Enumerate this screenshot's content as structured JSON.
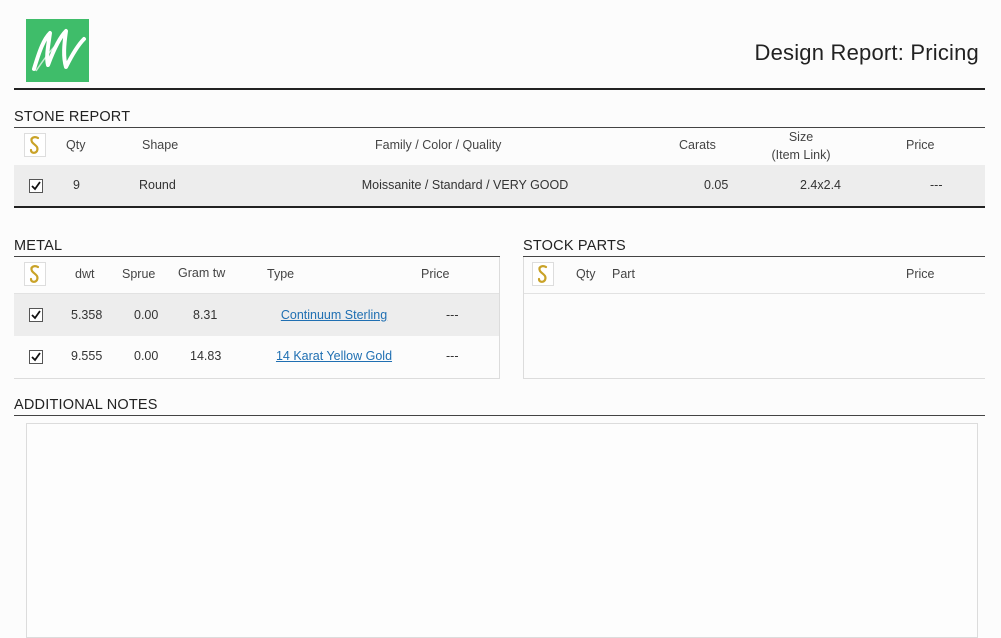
{
  "header": {
    "title": "Design Report: Pricing",
    "logo_icon": "green-m-logo"
  },
  "stone": {
    "section_title": "STONE REPORT",
    "columns": {
      "qty": "Qty",
      "shape": "Shape",
      "family": "Family / Color / Quality",
      "carats": "Carats",
      "size": "Size",
      "size_sub": "(Item Link)",
      "price": "Price"
    },
    "rows": [
      {
        "checked": true,
        "qty": "9",
        "shape": "Round",
        "family": "Moissanite / Standard / VERY GOOD",
        "carats": "0.05",
        "size": "2.4x2.4",
        "price": "---"
      }
    ]
  },
  "metal": {
    "section_title": "METAL",
    "columns": {
      "dwt": "dwt",
      "sprue": "Sprue",
      "gram": "Gram tw",
      "type": "Type",
      "price": "Price"
    },
    "rows": [
      {
        "checked": true,
        "dwt": "5.358",
        "sprue": "0.00",
        "gram": "8.31",
        "type": "Continuum Sterling",
        "price": "---"
      },
      {
        "checked": true,
        "dwt": "9.555",
        "sprue": "0.00",
        "gram": "14.83",
        "type": "14 Karat Yellow Gold",
        "price": "---"
      }
    ]
  },
  "stock": {
    "section_title": "STOCK PARTS",
    "columns": {
      "qty": "Qty",
      "part": "Part",
      "price": "Price"
    }
  },
  "notes": {
    "section_title": "ADDITIONAL NOTES"
  },
  "colors": {
    "brand_green": "#3fbd6a",
    "link": "#1f6fb2",
    "row_shade": "#ededed",
    "gold": "#c9a227"
  }
}
